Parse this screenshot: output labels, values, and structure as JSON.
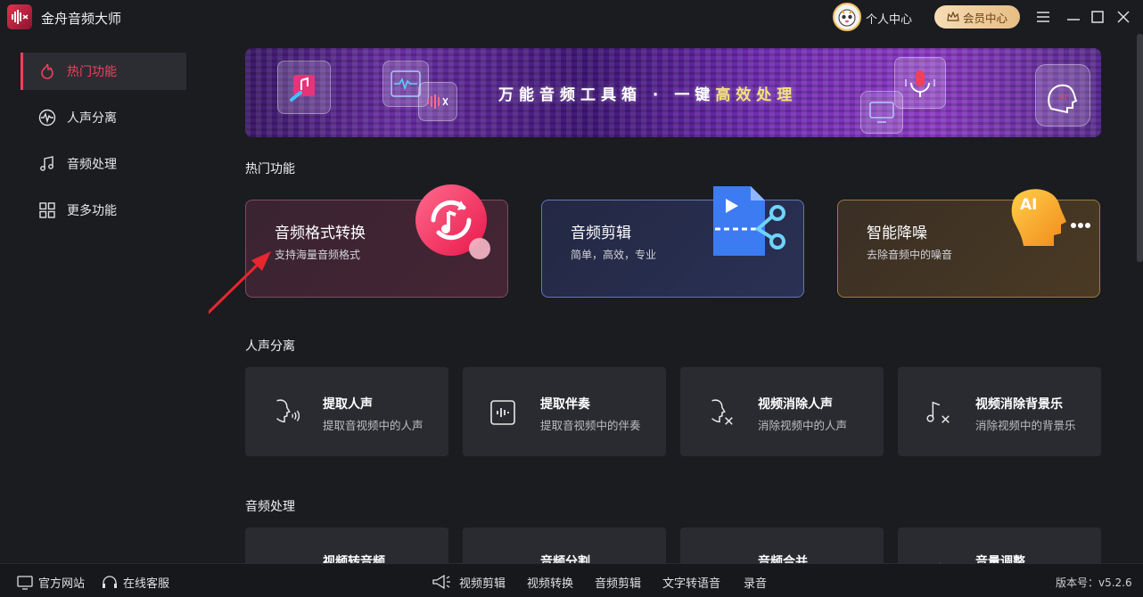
{
  "app": {
    "title": "金舟音频大师"
  },
  "header": {
    "user_center": "个人中心",
    "vip": "会员中心"
  },
  "sidebar": {
    "items": [
      {
        "label": "热门功能",
        "icon": "fire-icon",
        "active": true
      },
      {
        "label": "人声分离",
        "icon": "waveform-icon",
        "active": false
      },
      {
        "label": "音频处理",
        "icon": "music-note-icon",
        "active": false
      },
      {
        "label": "更多功能",
        "icon": "grid-icon",
        "active": false
      }
    ]
  },
  "banner": {
    "text_a": "万能音频工具箱",
    "dot": "·",
    "text_b": "一键",
    "text_c": "高效处理"
  },
  "hot": {
    "section_title": "热门功能",
    "cards": [
      {
        "title": "音频格式转换",
        "sub": "支持海量音频格式",
        "icon": "format-convert-icon",
        "accent": "#f0405a"
      },
      {
        "title": "音频剪辑",
        "sub": "简单，高效，专业",
        "icon": "scissors-icon",
        "accent": "#3d7bf2"
      },
      {
        "title": "智能降噪",
        "sub": "去除音频中的噪音",
        "icon": "ai-head-icon",
        "accent": "#f4a52a"
      }
    ]
  },
  "vocal": {
    "section_title": "人声分离",
    "cards": [
      {
        "title": "提取人声",
        "sub": "提取音视频中的人声",
        "icon": "voice-head-icon"
      },
      {
        "title": "提取伴奏",
        "sub": "提取音视频中的伴奏",
        "icon": "accompaniment-icon"
      },
      {
        "title": "视频消除人声",
        "sub": "消除视频中的人声",
        "icon": "remove-voice-icon"
      },
      {
        "title": "视频消除背景乐",
        "sub": "消除视频中的背景乐",
        "icon": "remove-music-icon"
      }
    ]
  },
  "audio": {
    "section_title": "音频处理",
    "cards": [
      {
        "title": "视频转音频",
        "icon": "video-to-audio-icon"
      },
      {
        "title": "音频分割",
        "icon": "split-icon"
      },
      {
        "title": "音频合并",
        "icon": "merge-icon"
      },
      {
        "title": "音量调整",
        "icon": "volume-icon"
      }
    ]
  },
  "footer": {
    "website": "官方网站",
    "service": "在线客服",
    "links": [
      "视频剪辑",
      "视频转换",
      "音频剪辑",
      "文字转语音",
      "录音"
    ],
    "version": "版本号：v5.2.6"
  }
}
